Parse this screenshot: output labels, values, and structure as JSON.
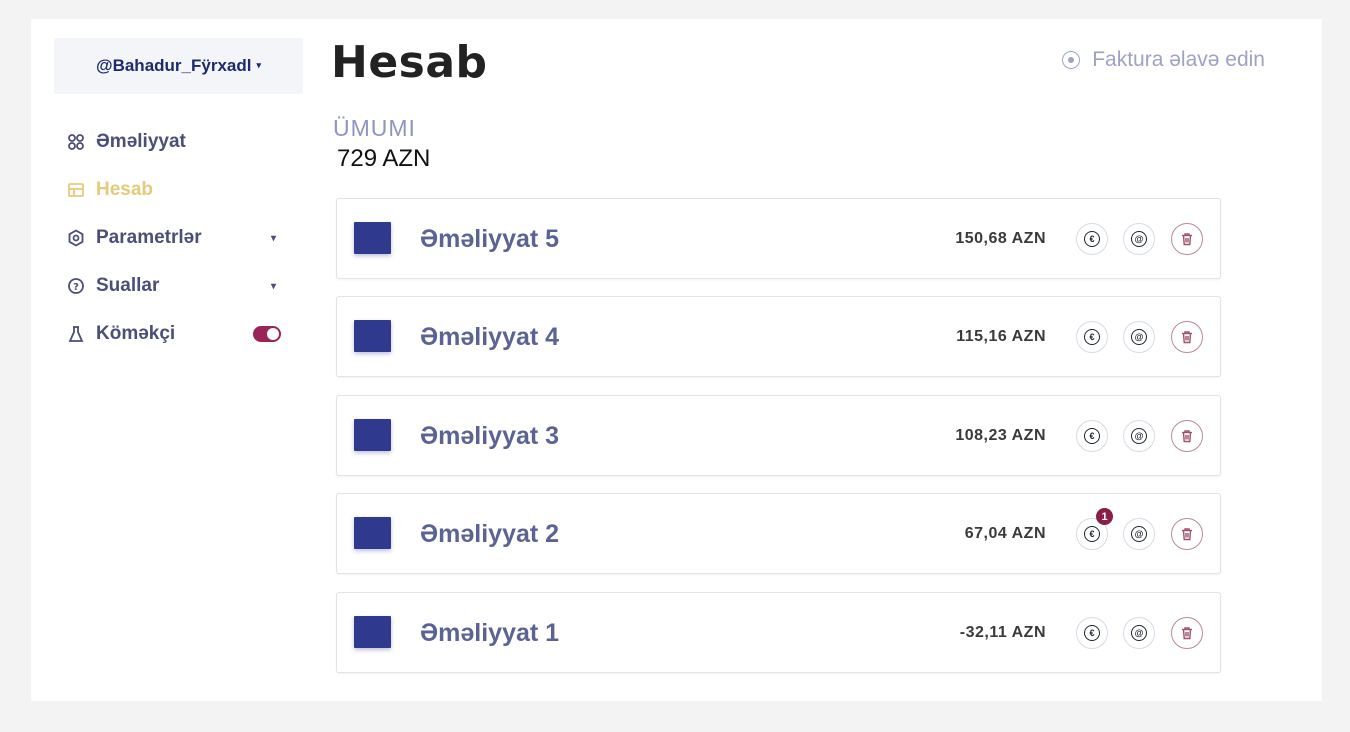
{
  "user": {
    "handle": "@Bahadur_Fÿrxadl",
    "caret": "▾"
  },
  "nav": {
    "items": [
      {
        "label": "Əməliyyat",
        "icon": "grid-icon"
      },
      {
        "label": "Hesab",
        "icon": "card-icon",
        "active": true
      },
      {
        "label": "Parametrlər",
        "icon": "settings-icon",
        "caret": "▾"
      },
      {
        "label": "Suallar",
        "icon": "question-icon",
        "caret": "▾"
      },
      {
        "label": "Köməkçi",
        "icon": "flask-icon",
        "toggle_on": true
      }
    ]
  },
  "header": {
    "title": "Hesab",
    "add_invoice": "Faktura əlavə edin"
  },
  "summary": {
    "label": "ÜMUMI",
    "value": "729 AZN"
  },
  "transactions": [
    {
      "name": "Əməliyyat 5",
      "amount": "150,68 AZN"
    },
    {
      "name": "Əməliyyat 4",
      "amount": "115,16 AZN"
    },
    {
      "name": "Əməliyyat 3",
      "amount": "108,23 AZN"
    },
    {
      "name": "Əməliyyat 2",
      "amount": "67,04 AZN",
      "badge": "1"
    },
    {
      "name": "Əməliyyat 1",
      "amount": "-32,11 AZN"
    }
  ],
  "row_buttons": {
    "euro": "€",
    "at": "@"
  },
  "colors": {
    "accent": "#9a2457",
    "active_nav": "#e3cb7b",
    "thumb": "#2f3a8f"
  }
}
